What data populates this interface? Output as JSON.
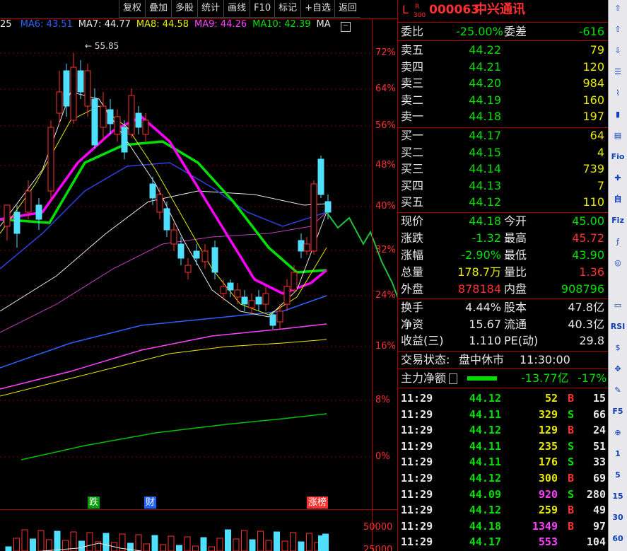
{
  "toolbar": {
    "buttons": [
      "复权",
      "叠加",
      "多股",
      "统计",
      "画线",
      "F10",
      "标记",
      "+自选",
      "返回"
    ]
  },
  "ma_row": {
    "partial": "25",
    "items": [
      {
        "label": "MA6: 43.51",
        "color": "#3060ff"
      },
      {
        "label": "MA7: 44.77",
        "color": "#e8e8e8"
      },
      {
        "label": "MA8: 44.58",
        "color": "#e8e800"
      },
      {
        "label": "MA9: 44.26",
        "color": "#ff40ff"
      },
      {
        "label": "MA10: 42.39",
        "color": "#00e000"
      },
      {
        "label": "MA",
        "color": "#e8e8e8"
      }
    ],
    "menu_icon": "minus-box-icon"
  },
  "price_axis": {
    "ticks": [
      "72%",
      "64%",
      "56%",
      "48%",
      "40%",
      "32%",
      "24%",
      "16%",
      "8%",
      "0%"
    ]
  },
  "peak_label": "55.85",
  "bottom_tags": [
    {
      "label": "跌",
      "color": "#00a000"
    },
    {
      "label": "财",
      "color": "#2060ff"
    },
    {
      "label": "涨榜",
      "color": "#ff3030"
    }
  ],
  "volume_axis": {
    "ticks": [
      "50000",
      "25000"
    ]
  },
  "header": {
    "l_mark": "L",
    "r_mark": "R",
    "r_sub": "300",
    "code": "000063",
    "name": "中兴通讯"
  },
  "weibi": {
    "label1": "委比",
    "value1": "-25.00%",
    "label2": "委差",
    "value2": "-616"
  },
  "asks": [
    {
      "label": "卖五",
      "price": "44.22",
      "vol": "79"
    },
    {
      "label": "卖四",
      "price": "44.21",
      "vol": "120"
    },
    {
      "label": "卖三",
      "price": "44.20",
      "vol": "984"
    },
    {
      "label": "卖二",
      "price": "44.19",
      "vol": "160"
    },
    {
      "label": "卖一",
      "price": "44.18",
      "vol": "197"
    }
  ],
  "bids": [
    {
      "label": "买一",
      "price": "44.17",
      "vol": "64"
    },
    {
      "label": "买二",
      "price": "44.15",
      "vol": "4"
    },
    {
      "label": "买三",
      "price": "44.14",
      "vol": "739"
    },
    {
      "label": "买四",
      "price": "44.13",
      "vol": "7"
    },
    {
      "label": "买五",
      "price": "44.12",
      "vol": "110"
    }
  ],
  "stats": [
    {
      "l1": "现价",
      "v1": "44.18",
      "c1": "#00e000",
      "l2": "今开",
      "v2": "45.00",
      "c2": "#00e000"
    },
    {
      "l1": "涨跌",
      "v1": "-1.32",
      "c1": "#00e000",
      "l2": "最高",
      "v2": "45.72",
      "c2": "#ff3030"
    },
    {
      "l1": "涨幅",
      "v1": "-2.90%",
      "c1": "#00e000",
      "l2": "最低",
      "v2": "43.90",
      "c2": "#00e000"
    },
    {
      "l1": "总量",
      "v1": "178.7万",
      "c1": "#e8e800",
      "l2": "量比",
      "v2": "1.36",
      "c2": "#ff3030"
    },
    {
      "l1": "外盘",
      "v1": "878184",
      "c1": "#ff3030",
      "l2": "内盘",
      "v2": "908796",
      "c2": "#00e000"
    }
  ],
  "fund": [
    {
      "l1": "换手",
      "v1": "4.44%",
      "l2": "股本",
      "v2": "47.8亿"
    },
    {
      "l1": "净资",
      "v1": "15.67",
      "l2": "流通",
      "v2": "40.3亿"
    },
    {
      "l1": "收益(三)",
      "v1": "1.110",
      "l2": "PE(动)",
      "v2": "29.8"
    }
  ],
  "trade_status": {
    "label": "交易状态:",
    "status": "盘中休市",
    "time": "11:30:00"
  },
  "main_flow": {
    "label": "主力净额",
    "value": "-13.77亿",
    "pct": "-17%"
  },
  "ticks": [
    {
      "time": "11:29",
      "price": "44.12",
      "vol": "52",
      "vol_color": "#e8e800",
      "side": "B",
      "side_color": "#ff3030",
      "n": "15"
    },
    {
      "time": "11:29",
      "price": "44.11",
      "vol": "329",
      "vol_color": "#e8e800",
      "side": "S",
      "side_color": "#00e000",
      "n": "66"
    },
    {
      "time": "11:29",
      "price": "44.12",
      "vol": "129",
      "vol_color": "#e8e800",
      "side": "B",
      "side_color": "#ff3030",
      "n": "24"
    },
    {
      "time": "11:29",
      "price": "44.11",
      "vol": "235",
      "vol_color": "#e8e800",
      "side": "S",
      "side_color": "#00e000",
      "n": "51"
    },
    {
      "time": "11:29",
      "price": "44.11",
      "vol": "176",
      "vol_color": "#e8e800",
      "side": "S",
      "side_color": "#00e000",
      "n": "33"
    },
    {
      "time": "11:29",
      "price": "44.12",
      "vol": "300",
      "vol_color": "#e8e800",
      "side": "B",
      "side_color": "#ff3030",
      "n": "69"
    },
    {
      "time": "11:29",
      "price": "44.09",
      "vol": "920",
      "vol_color": "#ff40ff",
      "side": "S",
      "side_color": "#00e000",
      "n": "280"
    },
    {
      "time": "11:29",
      "price": "44.12",
      "vol": "259",
      "vol_color": "#e8e800",
      "side": "B",
      "side_color": "#ff3030",
      "n": "49"
    },
    {
      "time": "11:29",
      "price": "44.18",
      "vol": "1349",
      "vol_color": "#ff40ff",
      "side": "B",
      "side_color": "#ff3030",
      "n": "97"
    },
    {
      "time": "11:29",
      "price": "44.17",
      "vol": "553",
      "vol_color": "#ff40ff",
      "side": "",
      "side_color": "#ff3030",
      "n": "104"
    }
  ],
  "side_toolbar": [
    "up-arrow-icon",
    "up-outline-arrow-icon",
    "down-outline-arrow-icon",
    "list-icon",
    "line-chart-icon",
    "candlestick-icon",
    "screen-icon",
    "f10-icon",
    "cross-icon",
    "self-icon",
    "f12-icon",
    "fx-icon",
    "circle-icon",
    "blank-icon",
    "monitor-icon",
    "rsi-icon",
    "dollar-icon",
    "move-icon",
    "pencil-icon",
    "F5",
    "fx2-icon",
    "1",
    "5",
    "15",
    "30",
    "60"
  ],
  "side_text": {
    "f5": "F5",
    "t1": "1",
    "t5": "5",
    "t15": "15",
    "t30": "30",
    "t60": "60",
    "rsi": "RSI",
    "fio": "Fio",
    "fiz": "Fiz",
    "self": "自"
  }
}
